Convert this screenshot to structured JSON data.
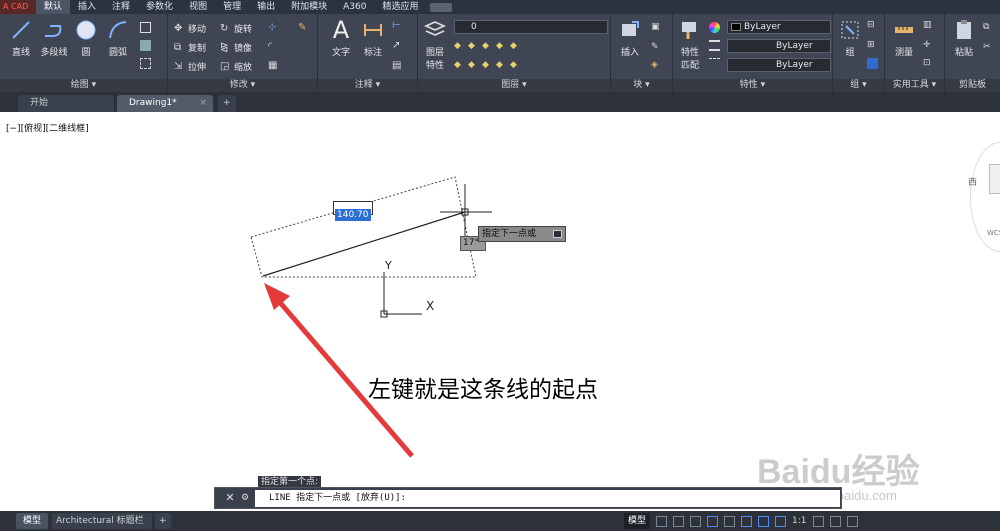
{
  "app_logo": "A CAD",
  "menu_tabs": [
    "默认",
    "插入",
    "注释",
    "参数化",
    "视图",
    "管理",
    "输出",
    "附加模块",
    "A360",
    "精选应用"
  ],
  "ribbon": {
    "draw": {
      "line": "直线",
      "polyline": "多段线",
      "circle": "圆",
      "arc": "圆弧",
      "title": "绘图 ▾"
    },
    "modify": {
      "move": "移动",
      "rotate": "旋转",
      "copy": "复制",
      "mirror": "镜像",
      "stretch": "拉伸",
      "scale": "缩放",
      "title": "修改 ▾"
    },
    "annotation": {
      "text": "文字",
      "dimension": "标注",
      "title": "注释 ▾"
    },
    "layers": {
      "properties_line1": "图层",
      "properties_line2": "特性",
      "layer_value": "0",
      "title": "图层 ▾"
    },
    "block": {
      "insert": "插入",
      "title": "块 ▾"
    },
    "properties": {
      "match_line1": "特性",
      "match_line2": "匹配",
      "color": "ByLayer",
      "linetype": "ByLayer",
      "lineweight": "ByLayer",
      "title": "特性 ▾"
    },
    "groups": {
      "group": "组",
      "title": "组 ▾"
    },
    "utilities": {
      "measure": "测量",
      "title": "实用工具 ▾"
    },
    "clipboard": {
      "paste": "粘贴",
      "title": "剪贴板"
    }
  },
  "doc_tabs": {
    "start": "开始",
    "drawing": "Drawing1*",
    "close": "×",
    "add": "+"
  },
  "canvas": {
    "view_label": "[−][俯视][二维线框]",
    "dynamic_input": "140.70",
    "angle": "17°",
    "tooltip_prompt": "指定下一点或",
    "y_axis": "Y",
    "x_axis": "X",
    "viewcube_west": "西",
    "wcs": "WCS"
  },
  "command": {
    "history": "指定第一个点:",
    "input": "LINE 指定下一点或 [放弃(U)]:",
    "close": "✕",
    "customize": "🔧"
  },
  "subtitle": "左键就是这条线的起点",
  "watermark": {
    "main": "Baidu经验",
    "url": "jingyan.baidu.com"
  },
  "status": {
    "model_tab": "模型",
    "layout_tab": "Architectural 标题栏",
    "add": "+",
    "mode": "模型",
    "scale": "1:1"
  },
  "colors": {
    "ribbon_bg": "#3f4552",
    "accent_blue": "#2e6fd4",
    "arrow_red": "#e43a3a"
  }
}
